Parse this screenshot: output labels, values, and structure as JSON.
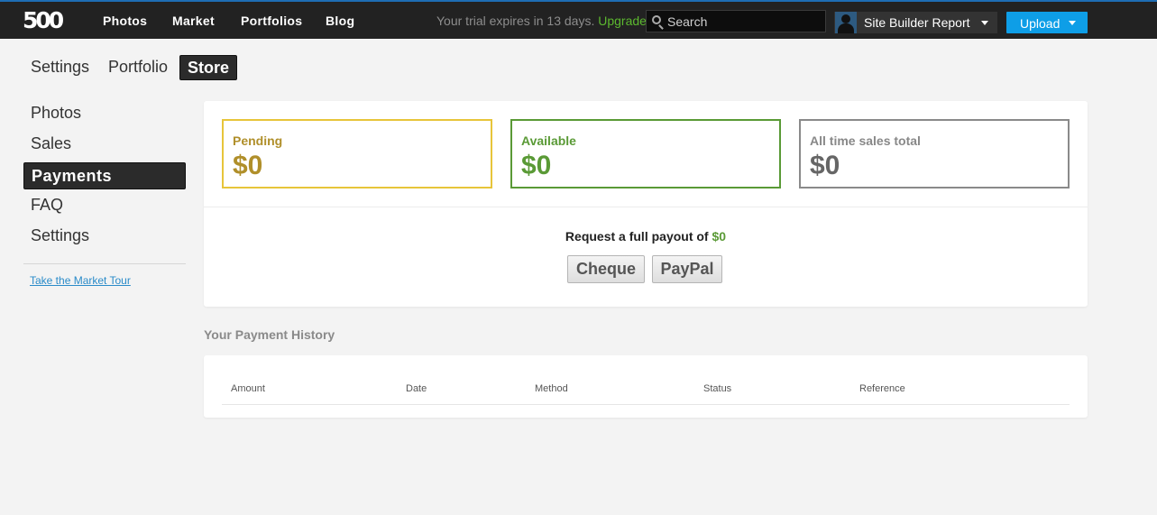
{
  "topbar": {
    "logo": "500",
    "nav": [
      "Photos",
      "Market",
      "Portfolios",
      "Blog"
    ],
    "trial_text": "Your trial expires in 13 days.",
    "upgrade_label": "Upgrade.",
    "search_placeholder": "Search",
    "user_name": "Site Builder Report",
    "upload_label": "Upload"
  },
  "tabs": [
    "Settings",
    "Portfolio",
    "Store"
  ],
  "active_tab": "Store",
  "sidebar": {
    "items": [
      "Photos",
      "Sales",
      "Payments",
      "FAQ",
      "Settings"
    ],
    "active": "Payments",
    "tour_link": "Take the Market Tour"
  },
  "summary": {
    "pending_label": "Pending",
    "pending_amount": "$0",
    "available_label": "Available",
    "available_amount": "$0",
    "alltime_label": "All time sales total",
    "alltime_amount": "$0",
    "request_text": "Request a full payout of",
    "request_amount": "$0",
    "cheque_label": "Cheque",
    "paypal_label": "PayPal"
  },
  "history": {
    "title": "Your Payment History",
    "columns": [
      "Amount",
      "Date",
      "Method",
      "Status",
      "Reference"
    ]
  },
  "colors": {
    "topbar_bg": "#222222",
    "upload_blue": "#0e9ee7",
    "pending_gold": "#e7c53a",
    "available_green": "#5a9a36",
    "upgrade_green": "#5cb82f"
  }
}
